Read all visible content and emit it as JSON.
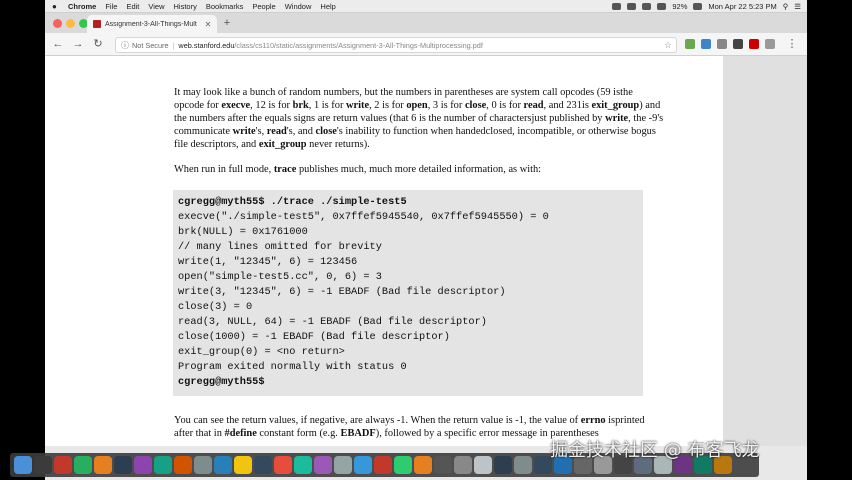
{
  "menubar": {
    "app": "Chrome",
    "items": [
      "File",
      "Edit",
      "View",
      "History",
      "Bookmarks",
      "People",
      "Window",
      "Help"
    ],
    "battery": "92%",
    "datetime": "Mon Apr 22  5:23 PM"
  },
  "browser": {
    "tab_title": "Assignment-3-All-Things-Mult",
    "security_label": "Not Secure",
    "url_host": "web.stanford.edu",
    "url_path": "/class/cs110/static/assignments/Assignment-3-All-Things-Multiprocessing.pdf"
  },
  "document": {
    "para1": [
      {
        "t": "It may look like a bunch of random numbers, but the numbers in parentheses are system call opcodes (59 is"
      },
      {
        "t": "the opcode for "
      },
      {
        "t": "execve",
        "b": true
      },
      {
        "t": ", 12 is for "
      },
      {
        "t": "brk",
        "b": true
      },
      {
        "t": ", 1 is for "
      },
      {
        "t": "write",
        "b": true
      },
      {
        "t": ", 2 is for "
      },
      {
        "t": "open",
        "b": true
      },
      {
        "t": ", 3 is for "
      },
      {
        "t": "close",
        "b": true
      },
      {
        "t": ", 0 is for "
      },
      {
        "t": "read",
        "b": true
      },
      {
        "t": ", and 231"
      },
      {
        "t": "is "
      },
      {
        "t": "exit_group",
        "b": true
      },
      {
        "t": ") and the numbers after the equals signs are return values (that 6 is the number of characters"
      },
      {
        "t": "just published by "
      },
      {
        "t": "write",
        "b": true
      },
      {
        "t": ", the -9's communicate "
      },
      {
        "t": "write",
        "b": true
      },
      {
        "t": "'s, "
      },
      {
        "t": "read",
        "b": true
      },
      {
        "t": "'s, and "
      },
      {
        "t": "close",
        "b": true
      },
      {
        "t": "'s inability to function when handed"
      },
      {
        "t": "closed, incompatible, or otherwise bogus file descriptors, and "
      },
      {
        "t": "exit_group",
        "b": true
      },
      {
        "t": " never returns)."
      }
    ],
    "para2": [
      {
        "t": "When run in full mode, "
      },
      {
        "t": "trace",
        "b": true
      },
      {
        "t": " publishes much, much more detailed information, as with:"
      }
    ],
    "code_lines": [
      {
        "text": "cgregg@myth55$ ./trace ./simple-test5",
        "prompt": true
      },
      {
        "text": "execve(\"./simple-test5\", 0x7ffef5945540, 0x7ffef5945550) = 0"
      },
      {
        "text": "brk(NULL) = 0x1761000"
      },
      {
        "text": "// many lines omitted for brevity"
      },
      {
        "text": "write(1, \"12345\", 6) = 123456"
      },
      {
        "text": "open(\"simple-test5.cc\", 0, 6) = 3"
      },
      {
        "text": "write(3, \"12345\", 6) = -1 EBADF (Bad file descriptor)"
      },
      {
        "text": "close(3) = 0"
      },
      {
        "text": "read(3, NULL, 64) = -1 EBADF (Bad file descriptor)"
      },
      {
        "text": "close(1000) = -1 EBADF (Bad file descriptor)"
      },
      {
        "text": "exit_group(0) = <no return>"
      },
      {
        "text": "Program exited normally with status 0"
      },
      {
        "text": "cgregg@myth55$",
        "prompt": true
      }
    ],
    "para3": [
      {
        "t": "You can see the return values, if negative, are always -1.  When the return value is -1, the value of "
      },
      {
        "t": "errno",
        "b": true
      },
      {
        "t": " is"
      },
      {
        "t": "printed after that in "
      },
      {
        "t": "#define",
        "b": true
      },
      {
        "t": " constant form (e.g. "
      },
      {
        "t": "EBADF",
        "b": true
      },
      {
        "t": "), followed by a specific error message in parentheses"
      }
    ]
  },
  "watermark": "掘金技术社区 @ 布客飞龙",
  "colors": {
    "code_bg": "#e4e4e4",
    "tab_favicon": "#b52025"
  },
  "dock_icons": [
    "#4a90d9",
    "#3b3b3b",
    "#c0392b",
    "#27ae60",
    "#e67e22",
    "#2c3e50",
    "#8e44ad",
    "#16a085",
    "#d35400",
    "#7f8c8d",
    "#2980b9",
    "#f1c40f",
    "#34495e",
    "#e74c3c",
    "#1abc9c",
    "#9b59b6",
    "#95a5a6",
    "#3498db",
    "#c0392b",
    "#2ecc71",
    "#e67e22",
    "#555555",
    "#888888",
    "#bdc3c7",
    "#2c3e50",
    "#7f8c8d",
    "#34495e",
    "#1f6fb2",
    "#666666",
    "#999999",
    "#444444",
    "#5d6d7e",
    "#aab7b8",
    "#6c3483",
    "#117a65",
    "#b9770e"
  ]
}
